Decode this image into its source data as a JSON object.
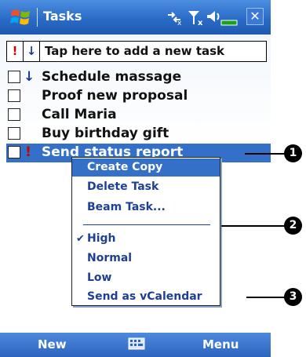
{
  "titlebar": {
    "title": "Tasks",
    "close_label": "✕"
  },
  "entrybar": {
    "priority_symbol": "!",
    "sort_symbol": "↓",
    "placeholder": "Tap here to add a new task"
  },
  "tasks": [
    {
      "priority": "↓",
      "label": "Schedule massage",
      "checked": false
    },
    {
      "priority": "",
      "label": "Proof new proposal",
      "checked": false
    },
    {
      "priority": "",
      "label": "Call Maria",
      "checked": false
    },
    {
      "priority": "",
      "label": "Buy birthday gift",
      "checked": false
    },
    {
      "priority": "!",
      "label": "Send status report",
      "checked": false
    }
  ],
  "context_menu": {
    "items": [
      "Create Copy",
      "Delete Task",
      "Beam Task..."
    ],
    "priority_items": [
      "High",
      "Normal",
      "Low"
    ],
    "checked_priority": "High",
    "send_item": "Send as vCalendar"
  },
  "bottombar": {
    "new_label": "New",
    "menu_label": "Menu"
  },
  "callouts": [
    "1",
    "2",
    "3"
  ],
  "colors": {
    "titlebar": "#2a6bc8",
    "selection": "#3570c8",
    "menu_text": "#1f3f94",
    "priority_high": "#cc0000"
  },
  "icons": [
    "windows-start-icon",
    "network-icon",
    "no-signal-icon",
    "volume-icon",
    "battery-icon",
    "keyboard-icon"
  ]
}
